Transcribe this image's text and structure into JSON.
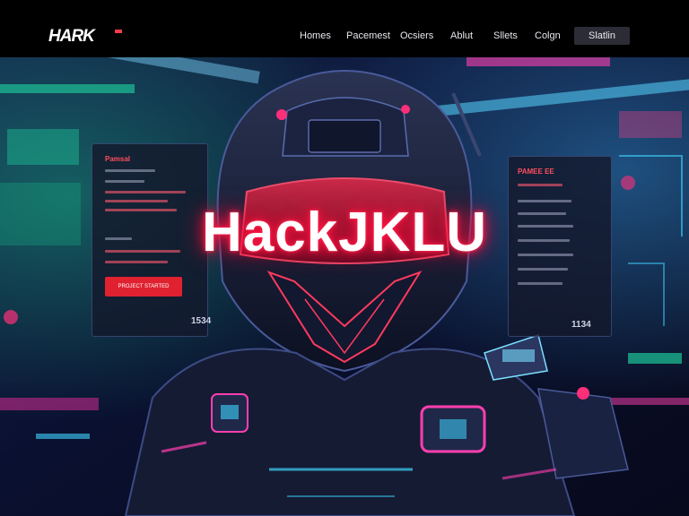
{
  "header": {
    "brand": "HARK",
    "nav": [
      "Homes",
      "Pacemest",
      "Ocsiers",
      "Ablut",
      "Sllets",
      "Colgn"
    ],
    "cta_label": "Slatlin"
  },
  "hero": {
    "headline": "HackJKLU",
    "left_panel": {
      "title": "Pamsal",
      "button_label": "PROJECT STARTED",
      "number": "1534"
    },
    "right_panel": {
      "title": "PAMEE EE",
      "number": "1134"
    }
  },
  "colors": {
    "accent_red": "#ff1744",
    "nav_bg": "#000000",
    "cta_bg": "#2c2c36",
    "neon_cyan": "#3fd4ff",
    "neon_magenta": "#ff2fa8"
  }
}
